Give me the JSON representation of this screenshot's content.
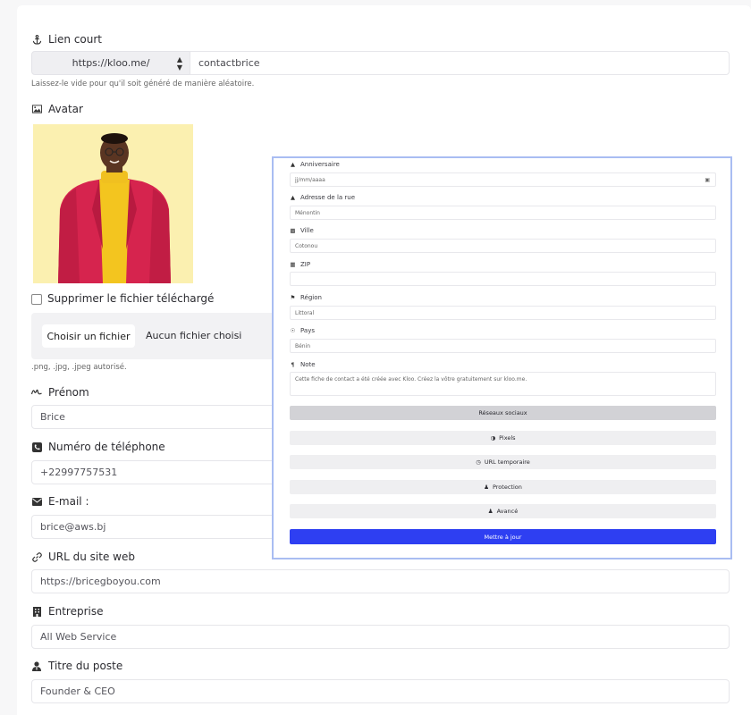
{
  "short_link": {
    "label": "Lien court",
    "prefix": "https://kloo.me/",
    "value": "contactbrice",
    "help": "Laissez-le vide pour qu'il soit généré de manière aléatoire."
  },
  "avatar": {
    "label": "Avatar",
    "delete_label": "Supprimer le fichier téléchargé",
    "choose_button": "Choisir un fichier",
    "no_file": "Aucun fichier choisi",
    "allowed": ".png, .jpg, .jpeg autorisé."
  },
  "fields": {
    "first_name": {
      "label": "Prénom",
      "value": "Brice"
    },
    "phone": {
      "label": "Numéro de téléphone",
      "value": "+22997757531"
    },
    "email": {
      "label": "E-mail :",
      "value": "brice@aws.bj"
    },
    "website": {
      "label": "URL du site web",
      "value": "https://bricegboyou.com"
    },
    "company": {
      "label": "Entreprise",
      "value": "All Web Service"
    },
    "job_title": {
      "label": "Titre du poste",
      "value": "Founder & CEO"
    }
  },
  "overlay": {
    "birthday": {
      "label": "Anniversaire",
      "value": "jj/mm/aaaa"
    },
    "street": {
      "label": "Adresse de la rue",
      "value": "Ménontin"
    },
    "city": {
      "label": "Ville",
      "value": "Cotonou"
    },
    "zip": {
      "label": "ZIP",
      "value": ""
    },
    "region": {
      "label": "Région",
      "value": "Littoral"
    },
    "country": {
      "label": "Pays",
      "value": "Bénin"
    },
    "note": {
      "label": "Note",
      "value": "Cette fiche de contact a été créée avec Kloo. Créez la vôtre gratuitement sur kloo.me."
    },
    "buttons": {
      "social": "Réseaux sociaux",
      "pixels": "Pixels",
      "temp_url": "URL temporaire",
      "protection": "Protection",
      "advanced": "Avancé"
    },
    "submit": "Mettre à jour"
  },
  "colors": {
    "primary": "#2e3ff2",
    "overlay_border": "#a9bdf2",
    "avatar_bg": "#fbf0b0"
  },
  "icons": {
    "short_link": "anchor-icon",
    "avatar": "image-icon",
    "first_name": "signature-icon",
    "phone": "phone-icon",
    "email": "envelope-icon",
    "website": "link-icon",
    "company": "building-icon",
    "job_title": "user-tie-icon"
  }
}
